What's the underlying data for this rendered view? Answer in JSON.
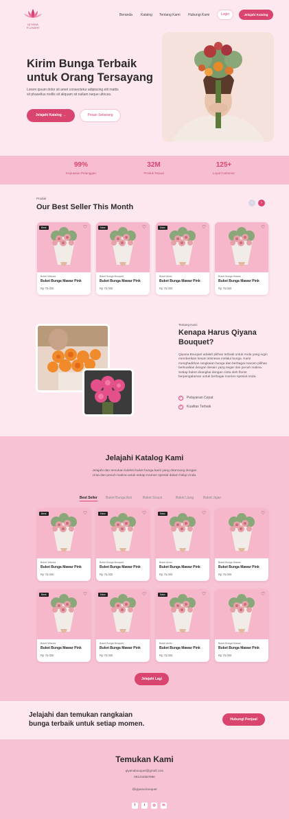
{
  "nav": {
    "logo_text": "QIYANA FLOWER",
    "links": [
      "Beranda",
      "Katalog",
      "Tentang Kami",
      "Hubungi Kami"
    ],
    "login_label": "Login",
    "catalog_label": "Jelajahi Katalog"
  },
  "hero": {
    "title_line1": "Kirim Bunga Terbaik",
    "title_line2": "untuk Orang Tersayang",
    "desc_line1": "Lorem ipsum dolor sit amet consectetur adipiscing elit mattis",
    "desc_line2": "sit phasellus mollis sit aliquam sit nullam neque ultrices.",
    "primary_label": "Jelajahi Katalog",
    "primary_icon": "arrow-right-icon",
    "secondary_label": "Pesan Sekarang"
  },
  "stats": [
    {
      "value": "99%",
      "label": "Kepuasan Pelanggan"
    },
    {
      "value": "32M",
      "label": "Produk Terjual"
    },
    {
      "value": "125+",
      "label": "Loyal Customer"
    }
  ],
  "best_seller": {
    "eyebrow": "Produk",
    "title": "Our Best Seller This Month",
    "products": [
      {
        "tag": "Best",
        "category": "Buket Wisuda",
        "name": "Buket Bunga Mawar Pink",
        "price": "Rp 75.000"
      },
      {
        "tag": "New",
        "category": "Buket Bunga Bouquet",
        "name": "Buket Bunga Mawar Pink",
        "price": "Rp 75.000"
      },
      {
        "tag": "New",
        "category": "Buket Anniv",
        "name": "Buket Bunga Mawar Pink",
        "price": "Rp 75.000"
      },
      {
        "tag": "",
        "category": "Buket Bunga Hiasan",
        "name": "Buket Bunga Mawar Pink",
        "price": "Rp 75.000"
      }
    ]
  },
  "why": {
    "eyebrow": "Tentang Kami",
    "title_line1": "Kenapa Harus Qiyana",
    "title_line2": "Bouquet?",
    "desc": [
      "Qiyana Bouquet adalah pilihan terbaik untuk Anda yang ingin",
      "memberikan kesan istimewa melalui bunga. Kami",
      "menghadirkan rangkaian bunga dan berbagai macam pilihan",
      "berkualitas dengan desain yang segar dan penuh makna.",
      "Setiap buket dirangkai dengan cinta oleh florist",
      "berpengalaman untuk berbagai momen spesial Anda."
    ],
    "features": [
      "Pelayanan Cepat",
      "Kualitas Terbaik"
    ]
  },
  "catalog": {
    "title": "Jelajahi Katalog Kami",
    "desc_line1": "Jelajahi dan temukan koleksi buket bunga kami yang dirancang dengan",
    "desc_line2": "cinta dan penuh makna untuk setiap momen spesial dalam hidup Anda.",
    "tabs": [
      "Best Seller",
      "Buket Bunga Asli",
      "Buket Snack",
      "Buket Uang",
      "Buket Jajan"
    ],
    "products": [
      {
        "tag": "Best",
        "category": "Buket Wisuda",
        "name": "Buket Bunga Mawar Pink",
        "price": "Rp 75.000"
      },
      {
        "tag": "New",
        "category": "Buket Bunga Bouquet",
        "name": "Buket Bunga Mawar Pink",
        "price": "Rp 75.000"
      },
      {
        "tag": "New",
        "category": "Buket Anniv",
        "name": "Buket Bunga Mawar Pink",
        "price": "Rp 75.000"
      },
      {
        "tag": "",
        "category": "Buket Bunga Hiasan",
        "name": "Buket Bunga Mawar Pink",
        "price": "Rp 75.000"
      },
      {
        "tag": "Best",
        "category": "Buket Wisuda",
        "name": "Buket Bunga Mawar Pink",
        "price": "Rp 75.000"
      },
      {
        "tag": "New",
        "category": "Buket Bunga Bouquet",
        "name": "Buket Bunga Mawar Pink",
        "price": "Rp 75.000"
      },
      {
        "tag": "New",
        "category": "Buket Anniv",
        "name": "Buket Bunga Mawar Pink",
        "price": "Rp 75.000"
      },
      {
        "tag": "",
        "category": "Buket Bunga Hiasan",
        "name": "Buket Bunga Mawar Pink",
        "price": "Rp 75.000"
      }
    ],
    "more_label": "Jelajahi Lagi"
  },
  "cta": {
    "title_line1": "Jelajahi dan temukan rangkaian",
    "title_line2": "bunga terbaik untuk setiap momen.",
    "button_label": "Hubungi Penjual"
  },
  "footer": {
    "title": "Temukan Kami",
    "email": "qiyanabouquet@gmail.com",
    "phone": "081234567890",
    "handle": "@qiyana.bouquet",
    "socials": [
      "facebook-icon",
      "twitter-icon",
      "instagram-icon",
      "linkedin-icon"
    ]
  },
  "colors": {
    "accent": "#d9456f",
    "bg_light": "#fde8ef",
    "bg_pink": "#f7c3d4"
  }
}
